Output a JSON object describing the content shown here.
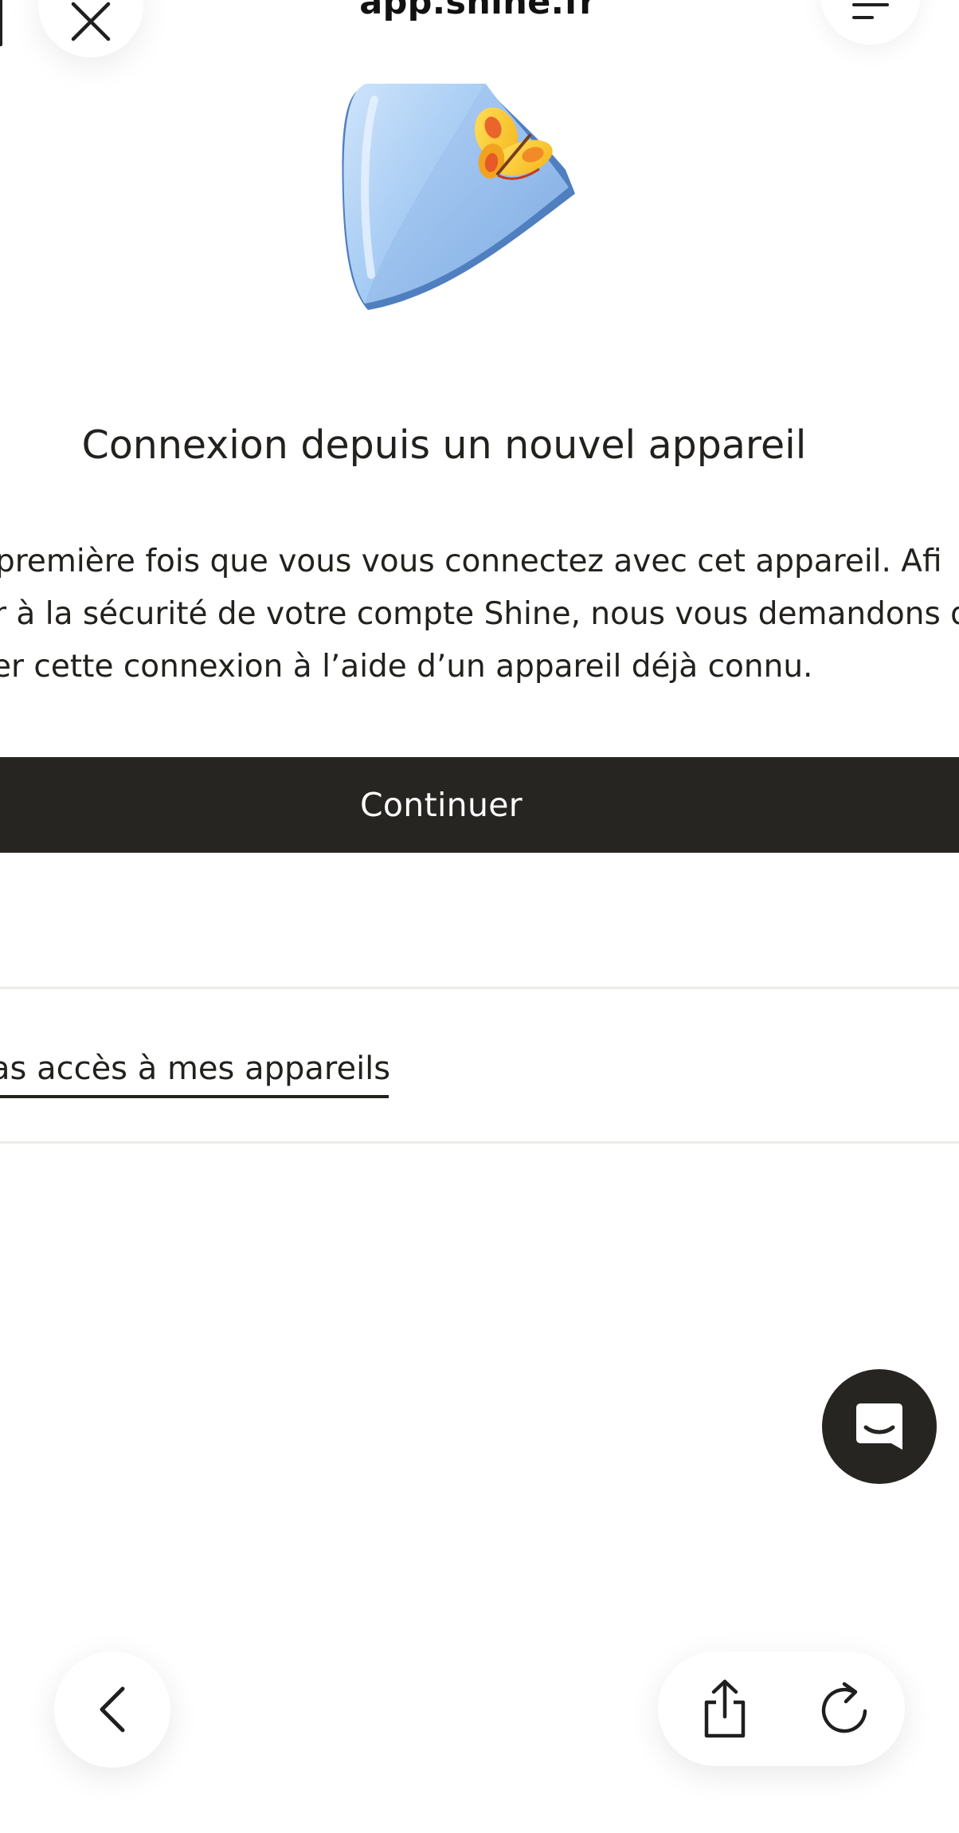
{
  "browser": {
    "url": "app.shine.fr",
    "close_icon": "close-icon",
    "menu_icon": "menu-icon"
  },
  "illustration": {
    "name": "shield-with-butterfly"
  },
  "main": {
    "title": "Connexion depuis un nouvel appareil",
    "body_lines": [
      "première fois que vous vous connectez avec cet appareil. Afi",
      "r à la sécurité de votre compte Shine, nous vous demandons d",
      "er cette connexion à l’aide d’un appareil déjà connu."
    ],
    "continue_label": "Continuer",
    "no_access_link": "as accès à mes appareils"
  },
  "chat": {
    "icon": "chat-icon"
  },
  "toolbar": {
    "back_icon": "back-icon",
    "share_icon": "share-icon",
    "reload_icon": "reload-icon"
  },
  "colors": {
    "dark": "#262521",
    "text": "#22211d",
    "divider": "#ecebe6",
    "background": "#ffffff"
  }
}
